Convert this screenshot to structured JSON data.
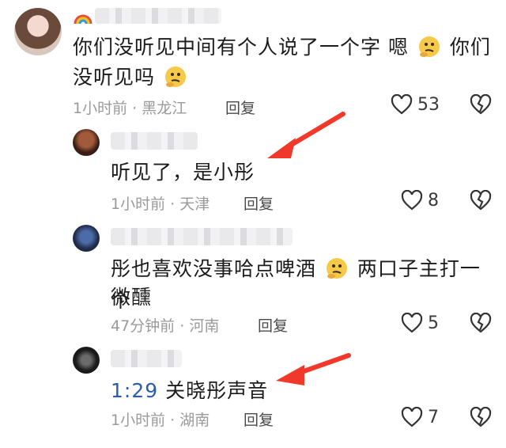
{
  "comments": [
    {
      "text_line1": "你们没听见中间有个人说了一个字 嗯",
      "text_line1b": "你们",
      "text_line2": "没听见吗",
      "time": "1小时前",
      "location": "黑龙江",
      "reply_label": "回复",
      "likes": "53"
    },
    {
      "text": "听见了，是小彤",
      "time": "1小时前",
      "location": "天津",
      "reply_label": "回复",
      "likes": "8"
    },
    {
      "text_line1": "彤也喜欢没事哈点啤酒",
      "text_line1b": "两口子主打一个",
      "text_line2": "微醺",
      "time": "47分钟前",
      "location": "河南",
      "reply_label": "回复",
      "likes": "5"
    },
    {
      "timestamp": "1:29",
      "text": "关晓彤声音",
      "time": "1小时前",
      "location": "湖南",
      "reply_label": "回复",
      "likes": "7"
    }
  ],
  "separator": "·",
  "colors": {
    "arrow": "#f0392b",
    "link": "#2a5db0",
    "meta": "#9a9a9a"
  },
  "icons": [
    "heart-outline-icon",
    "broken-heart-icon",
    "thinking-face-emoji",
    "rainbow-emoji"
  ]
}
